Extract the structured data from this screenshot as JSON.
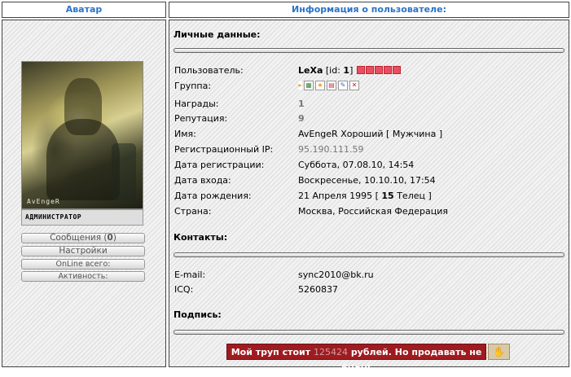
{
  "headers": {
    "avatar": "Аватар",
    "user_info": "Информация о пользователе:"
  },
  "left": {
    "avatar_signature": "AvEngeR",
    "rank_label": "АДМИНИСТРАТОР",
    "messages_label": "Сообщения (",
    "messages_count": "0",
    "messages_close": ")",
    "settings_label": "Настройки",
    "online_label": "OnLine всего:",
    "activity_label": "Активность:"
  },
  "sections": {
    "personal": "Личные данные:",
    "contacts": "Контакты:",
    "signature": "Подпись:"
  },
  "profile": {
    "user_label": "Пользователь:",
    "user_name": "LeXa",
    "user_id_prefix": "[id: ",
    "user_id": "1",
    "user_id_suffix": "]",
    "reputation_squares": 5,
    "group_label": "Группа:",
    "group_icons": [
      "flag-icon",
      "chart-icon",
      "star-icon",
      "doc-icon",
      "pencil-icon",
      "close-icon"
    ],
    "awards_label": "Награды:",
    "awards": "1",
    "reputation_label": "Репутация:",
    "reputation": "9",
    "name_label": "Имя:",
    "name": "AvEngeR Хороший [ Мужчина ]",
    "reg_ip_label": "Регистрационный IP:",
    "reg_ip": "95.190.111.59",
    "reg_date_label": "Дата регистрации:",
    "reg_date": "Суббота, 07.08.10, 14:54",
    "login_date_label": "Дата входа:",
    "login_date": "Воскресенье, 10.10.10, 17:54",
    "birth_label": "Дата рождения:",
    "birth_date": "21 Апреля 1995 [",
    "birth_age": "15",
    "birth_sign": "Телец ]",
    "country_label": "Страна:",
    "country": "Москва, Российская Федерация"
  },
  "contacts": {
    "email_label": "E-mail:",
    "email": "sync2010@bk.ru",
    "icq_label": "ICQ:",
    "icq": "5260837"
  },
  "banner": {
    "prefix": "Мой труп стоит",
    "amount": "125424",
    "suffix": "рублей. Но продавать не буду!"
  },
  "colors": {
    "header_text": "#2a73c8",
    "banner_bg": "#9e1b20",
    "reputation": "#e85060"
  }
}
